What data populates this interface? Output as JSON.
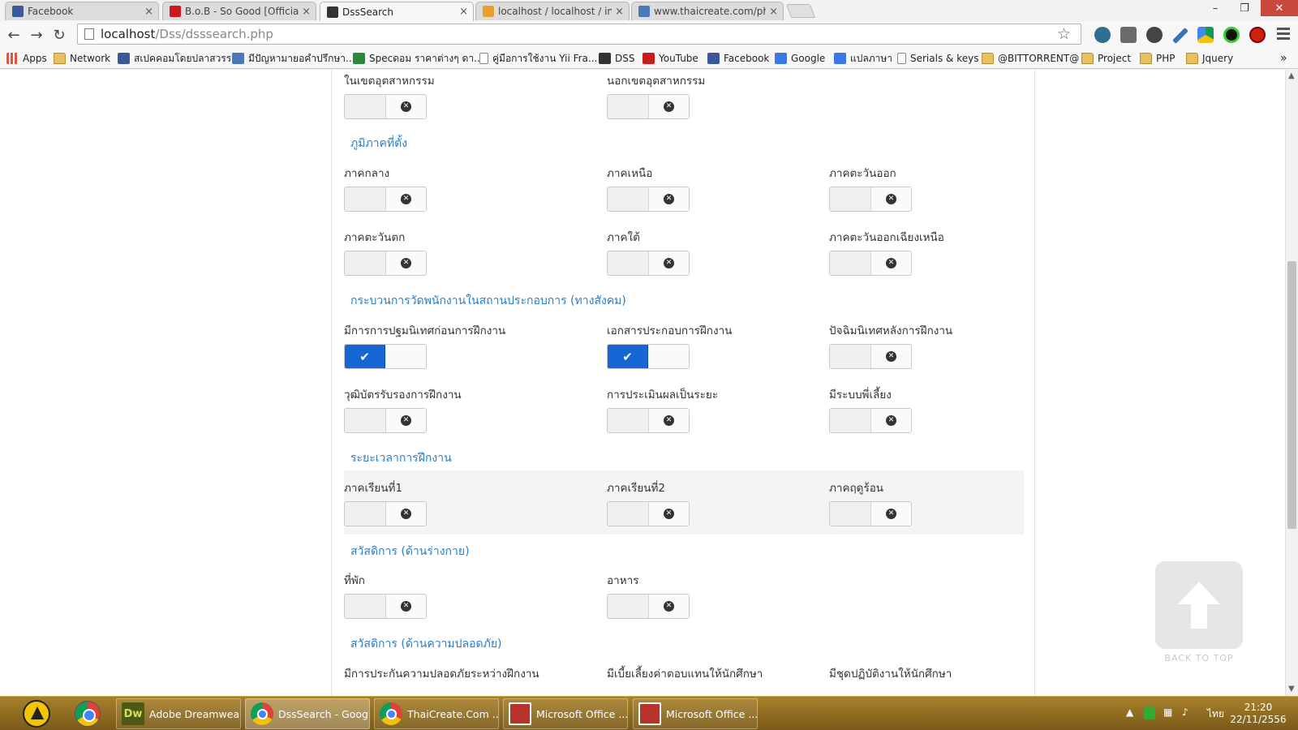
{
  "browser": {
    "tabs": [
      {
        "label": "Facebook",
        "favicon": "facebook-icon",
        "color": "#3b5998"
      },
      {
        "label": "B.o.B - So Good [Official V",
        "favicon": "youtube-icon",
        "color": "#cc181e"
      },
      {
        "label": "DssSearch",
        "favicon": "dss-icon",
        "color": "#333333"
      },
      {
        "label": "localhost / localhost / inte",
        "favicon": "phpmyadmin-icon",
        "color": "#e9a02b"
      },
      {
        "label": "www.thaicreate.com/php/",
        "favicon": "page-icon",
        "color": "#4a78b8"
      }
    ],
    "active_tab": 2,
    "url_host": "localhost",
    "url_path": "/Dss/dsssearch.php",
    "bookmarks": [
      {
        "label": "Apps",
        "icon": "apps-icon"
      },
      {
        "label": "Network",
        "icon": "folder-icon"
      },
      {
        "label": "สเปคคอมโดยปลาสวรรค์!",
        "icon": "facebook-icon"
      },
      {
        "label": "มีปัญหามายอคำปรึกษา...",
        "icon": "page-icon"
      },
      {
        "label": "Specดอม ราคาต่างๆ ดา...",
        "icon": "spec-icon"
      },
      {
        "label": "คู่มือการใช้งาน Yii Fra...",
        "icon": "doc-icon"
      },
      {
        "label": "DSS",
        "icon": "dss-icon"
      },
      {
        "label": "YouTube",
        "icon": "youtube-icon"
      },
      {
        "label": "Facebook",
        "icon": "facebook-icon"
      },
      {
        "label": "Google",
        "icon": "google-icon"
      },
      {
        "label": "แปลภาษา",
        "icon": "translate-icon"
      },
      {
        "label": "Serials & keys",
        "icon": "doc-icon"
      },
      {
        "label": "@BITTORRENT@",
        "icon": "folder-icon"
      },
      {
        "label": "Project",
        "icon": "folder-icon"
      },
      {
        "label": "PHP",
        "icon": "folder-icon"
      },
      {
        "label": "Jquery",
        "icon": "folder-icon"
      }
    ],
    "bookmarks_more": "»"
  },
  "page": {
    "sections": [
      {
        "heading": "",
        "items": [
          {
            "label": "ในเขตอุตสาหกรรม",
            "checked": false
          },
          {
            "label": "นอกเขตอุตสาหกรรม",
            "checked": false
          }
        ]
      },
      {
        "heading": "ภูมิภาคที่ตั้ง",
        "items": [
          {
            "label": "ภาคกลาง",
            "checked": false
          },
          {
            "label": "ภาคเหนือ",
            "checked": false
          },
          {
            "label": "ภาคตะวันออก",
            "checked": false
          },
          {
            "label": "ภาคตะวันตก",
            "checked": false
          },
          {
            "label": "ภาคใต้",
            "checked": false
          },
          {
            "label": "ภาคตะวันออกเฉียงเหนือ",
            "checked": false
          }
        ]
      },
      {
        "heading": "กระบวนการวัดพนักงานในสถานประกอบการ (ทางสังคม)",
        "items": [
          {
            "label": "มีการการปฐมนิเทศก่อนการฝึกงาน",
            "checked": true
          },
          {
            "label": "เอกสารประกอบการฝึกงาน",
            "checked": true
          },
          {
            "label": "ปัจฉิมนิเทศหลังการฝึกงาน",
            "checked": false
          },
          {
            "label": "วุฒิบัตรรับรองการฝึกงาน",
            "checked": false
          },
          {
            "label": "การประเมินผลเป็นระยะ",
            "checked": false
          },
          {
            "label": "มีระบบพี่เลี้ยง",
            "checked": false
          }
        ]
      },
      {
        "heading": "ระยะเวลาการฝึกงาน",
        "items": [
          {
            "label": "ภาคเรียนที่1",
            "checked": false
          },
          {
            "label": "ภาคเรียนที่2",
            "checked": false
          },
          {
            "label": "ภาคฤดูร้อน",
            "checked": false
          }
        ]
      },
      {
        "heading": "สวัสดิการ (ด้านร่างกาย)",
        "items": [
          {
            "label": "ที่พัก",
            "checked": false
          },
          {
            "label": "อาหาร",
            "checked": false
          }
        ]
      },
      {
        "heading": "สวัสดิการ (ด้านความปลอดภัย)",
        "items": [
          {
            "label": "มีการประกันความปลอดภัยระหว่างฝึกงาน",
            "checked": false
          },
          {
            "label": "มีเบี้ยเลี้ยงค่าตอบแทนให้นักศึกษา",
            "checked": false
          },
          {
            "label": "มีชุดปฏิบัติงานให้นักศึกษา",
            "checked": false
          }
        ]
      }
    ],
    "back_to_top_label": "BACK TO TOP",
    "accent_color": "#2a7fc8",
    "toggle_on_color": "#1766d6"
  },
  "taskbar": {
    "apps": [
      {
        "label": "Adobe Dreamwea...",
        "icon": "dreamweaver-icon",
        "active": false
      },
      {
        "label": "DssSearch - Goog...",
        "icon": "chrome-icon",
        "active": true
      },
      {
        "label": "ThaiCreate.Com ...",
        "icon": "chrome-icon",
        "active": false
      },
      {
        "label": "Microsoft Office ...",
        "icon": "office-icon",
        "active": false
      },
      {
        "label": "Microsoft Office ...",
        "icon": "office-icon",
        "active": false
      }
    ],
    "tray_lang": "ไทย",
    "time": "21:20",
    "date": "22/11/2556"
  }
}
